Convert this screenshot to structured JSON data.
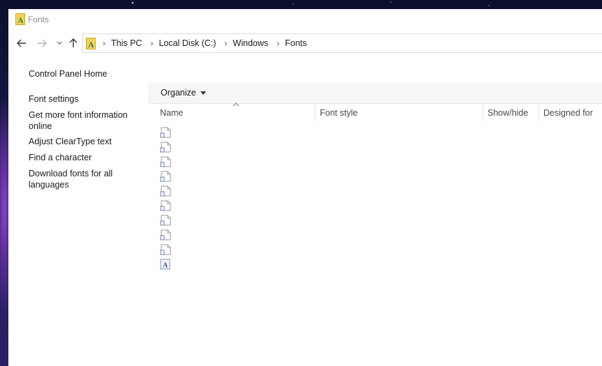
{
  "window": {
    "title": "Fonts"
  },
  "breadcrumb": [
    "This PC",
    "Local Disk (C:)",
    "Windows",
    "Fonts"
  ],
  "sidebar": {
    "home": "Control Panel Home",
    "links": [
      "Font settings",
      "Get more font information online",
      "Adjust ClearType text",
      "Find a character",
      "Download fonts for all languages"
    ]
  },
  "toolbar": {
    "organize": "Organize"
  },
  "columns": [
    "Name",
    "Font style",
    "Show/hide",
    "Designed for"
  ],
  "icons": {
    "back": "back-arrow-icon",
    "forward": "forward-arrow-icon",
    "recent": "chevron-down-icon",
    "up": "up-arrow-icon",
    "folder": "fonts-folder-icon",
    "file": "font-file-icon",
    "font": "font-a-icon"
  },
  "colors": {
    "link": "#1a1a1a",
    "toolbar_bg": "#f5f6f7",
    "folder_icon": "#f2d25a",
    "folder_letter": "#2b8a3e"
  }
}
